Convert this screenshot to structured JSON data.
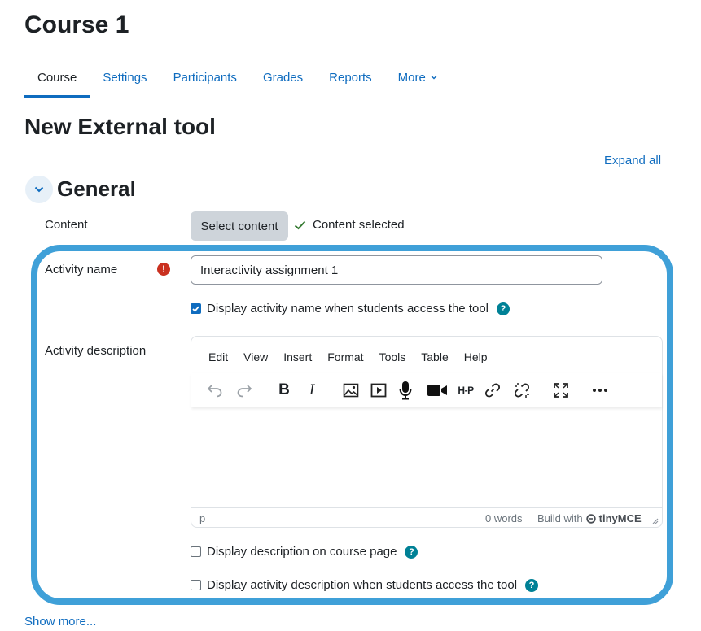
{
  "header": {
    "course_title": "Course 1"
  },
  "nav": {
    "tabs": [
      {
        "label": "Course",
        "active": true
      },
      {
        "label": "Settings"
      },
      {
        "label": "Participants"
      },
      {
        "label": "Grades"
      },
      {
        "label": "Reports"
      },
      {
        "label": "More"
      }
    ]
  },
  "page": {
    "title": "New External tool",
    "expand_all": "Expand all"
  },
  "general": {
    "title": "General",
    "content_label": "Content",
    "select_content_button": "Select content",
    "content_selected": "Content selected",
    "activity_name_label": "Activity name",
    "activity_name_value": "Interactivity assignment 1",
    "display_name_checkbox": "Display activity name when students access the tool",
    "display_name_checked": true,
    "activity_description_label": "Activity description",
    "display_description_checkbox": "Display description on course page",
    "display_activity_desc_checkbox": "Display activity description when students access the tool"
  },
  "editor": {
    "menu": [
      "Edit",
      "View",
      "Insert",
      "Format",
      "Tools",
      "Table",
      "Help"
    ],
    "toolbar_icons": [
      "undo-icon",
      "redo-icon",
      "bold-icon",
      "italic-icon",
      "image-icon",
      "media-icon",
      "microphone-icon",
      "video-camera-icon",
      "h5p-icon",
      "link-icon",
      "unlink-icon",
      "fullscreen-icon",
      "more-icon"
    ],
    "bold_glyph": "B",
    "italic_glyph": "I",
    "h5p_glyph": "H-P",
    "status_path": "p",
    "word_count": "0 words",
    "build_with": "Build with",
    "brand": "tinyMCE"
  },
  "footer": {
    "show_more": "Show more..."
  },
  "colors": {
    "accent": "#0f6cbf",
    "highlight": "#3fa0d8",
    "required": "#ca3120",
    "help": "#008196",
    "success": "#357a32"
  }
}
